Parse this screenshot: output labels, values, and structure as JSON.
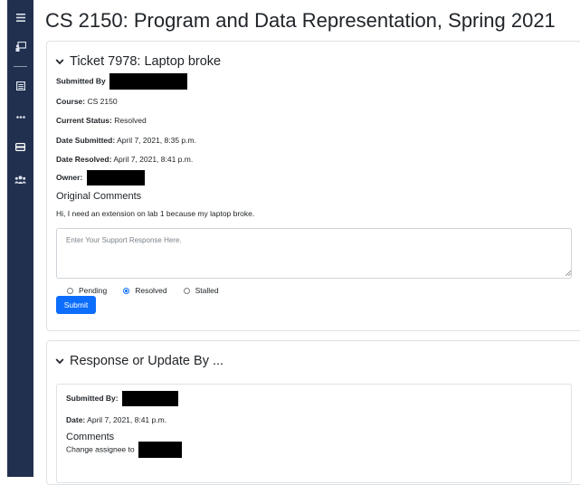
{
  "course_title": "CS 2150: Program and Data Representation, Spring 2021",
  "sidebar": {
    "items": [
      {
        "icon": "hamburger-menu-icon"
      },
      {
        "icon": "chalkboard-teacher-icon"
      },
      {
        "icon": "calendar-list-icon"
      },
      {
        "icon": "more-dots-icon"
      },
      {
        "icon": "ticket-card-icon"
      },
      {
        "icon": "users-group-icon"
      }
    ]
  },
  "ticket": {
    "header": "Ticket 7978: Laptop broke",
    "submitted_by_label": "Submitted By",
    "course_label": "Course:",
    "course_value": "CS 2150",
    "status_label": "Current Status:",
    "status_value": "Resolved",
    "date_submitted_label": "Date Submitted:",
    "date_submitted_value": "April 7, 2021, 8:35 p.m.",
    "date_resolved_label": "Date Resolved:",
    "date_resolved_value": "April 7, 2021, 8:41 p.m.",
    "owner_label": "Owner:",
    "original_comments_title": "Original Comments",
    "original_comments_text": "Hi, I need an extension on lab 1 because my laptop broke.",
    "response_placeholder": "Enter Your Support Response Here.",
    "status_options": [
      {
        "label": "Pending",
        "checked": false
      },
      {
        "label": "Resolved",
        "checked": true
      },
      {
        "label": "Stalled",
        "checked": false
      }
    ],
    "submit_label": "Submit"
  },
  "response": {
    "header": "Response or Update By ...",
    "submitted_by_label": "Submitted By:",
    "date_label": "Date:",
    "date_value": "April 7, 2021, 8:41 p.m.",
    "comments_title": "Comments",
    "comments_text": "Change assignee to"
  },
  "colors": {
    "sidebar_bg": "#21304f",
    "primary": "#0d6efd",
    "border": "#dee2e6",
    "redaction": "#000000"
  }
}
